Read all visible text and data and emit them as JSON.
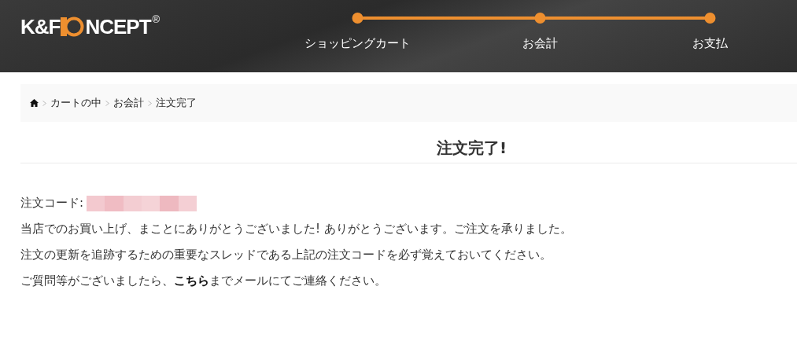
{
  "header": {
    "logo": {
      "left": "K&F",
      "right": "NCEPT",
      "mark": "®"
    },
    "steps": [
      {
        "label": "ショッピングカート"
      },
      {
        "label": "お会計"
      },
      {
        "label": "お支払"
      }
    ]
  },
  "breadcrumb": [
    "カートの中",
    "お会計",
    "注文完了"
  ],
  "title": "注文完了!",
  "order_code": {
    "label": "注文コード:"
  },
  "paragraphs": [
    {
      "text": "当店でのお買い上げ、まことにありがとうございました! ありがとうございます。ご注文を承りました。"
    },
    {
      "text": "注文の更新を追跡するための重要なスレッドである上記の注文コードを必ず覚えておいてください。"
    },
    {
      "before": "ご質問等がございましたら、",
      "link": "こちら",
      "after": "までメールにてご連絡ください。"
    }
  ]
}
